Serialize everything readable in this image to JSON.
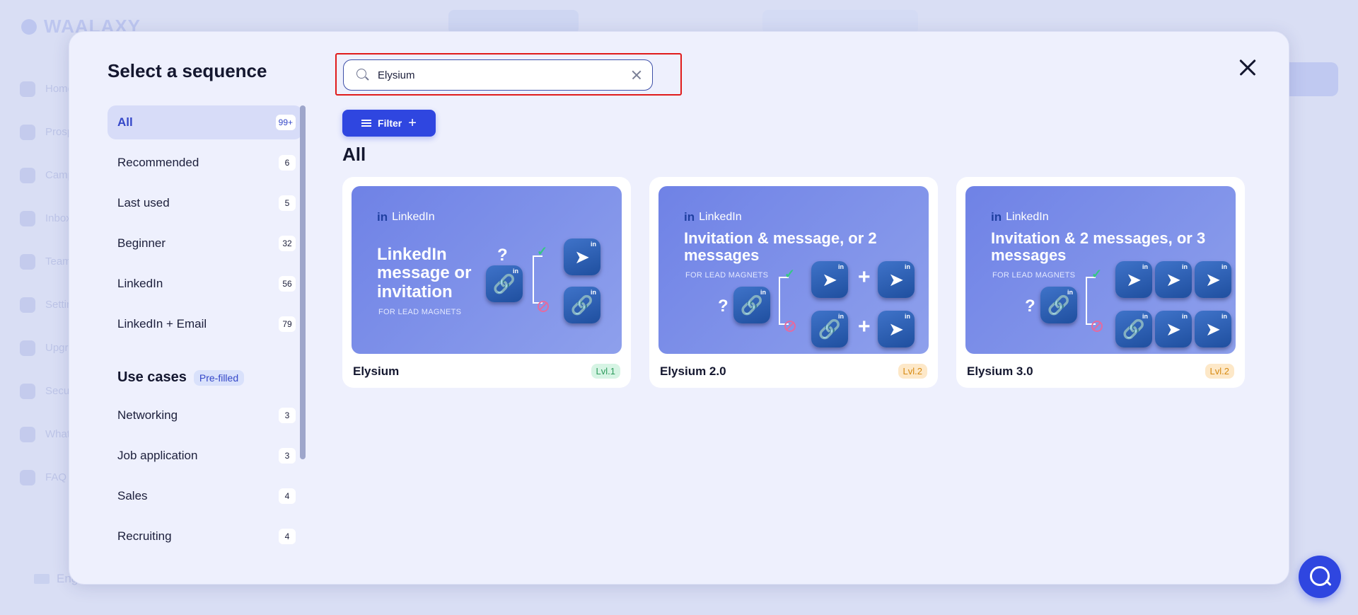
{
  "background": {
    "logo": "WAALAXY",
    "nav": [
      "Home",
      "Prospects",
      "Campaigns",
      "Inbox",
      "Team",
      "Settings",
      "Upgrade",
      "Security",
      "What's new",
      "FAQ"
    ],
    "language": "Eng"
  },
  "modal": {
    "title": "Select a sequence",
    "search": {
      "value": "Elysium",
      "placeholder": ""
    },
    "filter_label": "Filter",
    "section_heading": "All",
    "sidebar": {
      "items": [
        {
          "label": "All",
          "count": "99+"
        },
        {
          "label": "Recommended",
          "count": "6"
        },
        {
          "label": "Last used",
          "count": "5"
        },
        {
          "label": "Beginner",
          "count": "32"
        },
        {
          "label": "LinkedIn",
          "count": "56"
        },
        {
          "label": "LinkedIn + Email",
          "count": "79"
        }
      ],
      "use_cases_title": "Use cases",
      "use_cases_badge": "Pre-filled",
      "use_cases": [
        {
          "label": "Networking",
          "count": "3"
        },
        {
          "label": "Job application",
          "count": "3"
        },
        {
          "label": "Sales",
          "count": "4"
        },
        {
          "label": "Recruiting",
          "count": "4"
        }
      ]
    },
    "cards": [
      {
        "name": "Elysium",
        "level": "Lvl.1",
        "brand": "LinkedIn",
        "headline": "LinkedIn message or invitation",
        "sub": "FOR LEAD MAGNETS"
      },
      {
        "name": "Elysium 2.0",
        "level": "Lvl.2",
        "brand": "LinkedIn",
        "headline": "Invitation & message, or 2 messages",
        "sub": "FOR LEAD MAGNETS"
      },
      {
        "name": "Elysium 3.0",
        "level": "Lvl.2",
        "brand": "LinkedIn",
        "headline": "Invitation & 2 messages, or 3 messages",
        "sub": "FOR LEAD MAGNETS"
      }
    ]
  },
  "colors": {
    "primary": "#2f46e0",
    "highlight": "#e01b1b",
    "level1": "#2d9b5c",
    "level2": "#d78a12"
  }
}
